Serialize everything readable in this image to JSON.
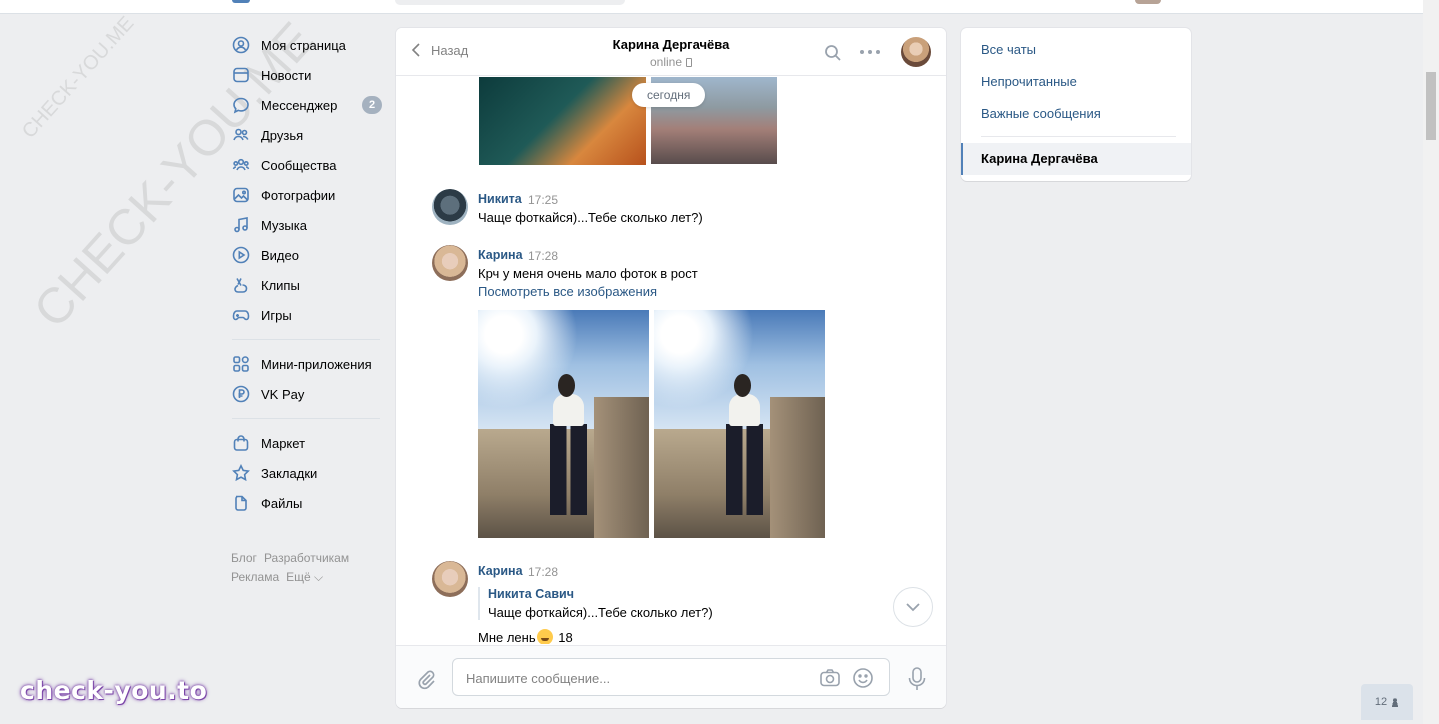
{
  "watermark": {
    "small": "CHECK-YOU.ME",
    "large": "CHECK-YOU.ME",
    "brand": "check-you.to"
  },
  "nav": {
    "items": [
      {
        "label": "Моя страница",
        "icon": "user-circle-icon"
      },
      {
        "label": "Новости",
        "icon": "newspaper-icon"
      },
      {
        "label": "Мессенджер",
        "icon": "chat-bubble-icon",
        "badge": "2"
      },
      {
        "label": "Друзья",
        "icon": "friends-icon"
      },
      {
        "label": "Сообщества",
        "icon": "communities-icon"
      },
      {
        "label": "Фотографии",
        "icon": "photo-icon"
      },
      {
        "label": "Музыка",
        "icon": "music-note-icon"
      },
      {
        "label": "Видео",
        "icon": "play-icon"
      },
      {
        "label": "Клипы",
        "icon": "clips-icon"
      },
      {
        "label": "Игры",
        "icon": "gamepad-icon"
      }
    ],
    "items2": [
      {
        "label": "Мини-приложения",
        "icon": "apps-grid-icon"
      },
      {
        "label": "VK Pay",
        "icon": "ruble-icon"
      }
    ],
    "items3": [
      {
        "label": "Маркет",
        "icon": "shopping-bag-icon"
      },
      {
        "label": "Закладки",
        "icon": "star-icon"
      },
      {
        "label": "Файлы",
        "icon": "file-icon"
      }
    ],
    "footer": [
      "Блог",
      "Разработчикам",
      "Реклама",
      "Ещё ⌵"
    ]
  },
  "chat": {
    "back_label": "Назад",
    "title": "Карина Дергачёва",
    "status": "online",
    "date_divider": "сегодня",
    "messages": [
      {
        "author": "Никита",
        "time": "17:25",
        "text": "Чаще фоткайся)...Тебе сколько лет?)"
      },
      {
        "author": "Карина",
        "time": "17:28",
        "text": "Крч у меня очень мало фоток в рост",
        "link": "Посмотреть все изображения"
      },
      {
        "author": "Карина",
        "time": "17:28",
        "quote_author": "Никита Савич",
        "quote_text": "Чаще фоткайся)...Тебе сколько лет?)",
        "text_before": "Мне лень",
        "text_after": " 18"
      }
    ],
    "composer": {
      "placeholder": "Напишите сообщение..."
    }
  },
  "right": {
    "items": [
      "Все чаты",
      "Непрочитанные",
      "Важные сообщения"
    ],
    "active": "Карина Дергачёва"
  },
  "online_counter": "12"
}
